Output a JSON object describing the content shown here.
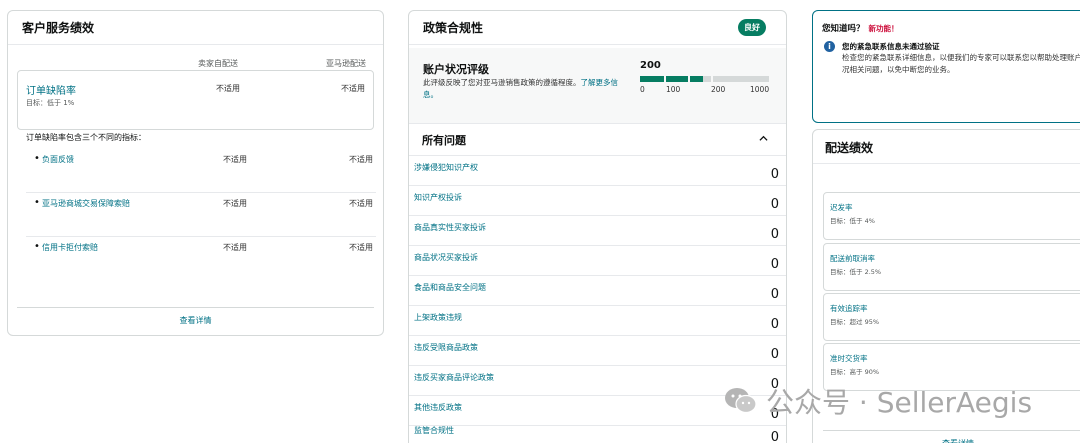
{
  "csp": {
    "title": "客户服务绩效",
    "col_seller": "卖家自配送",
    "col_amazon": "亚马逊配送",
    "odr": {
      "title": "订单缺陷率",
      "target": "目标：低于 1%",
      "seller": "不适用",
      "amazon": "不适用"
    },
    "intro": "订单缺陷率包含三个不同的指标：",
    "metrics": [
      {
        "label": "负面反馈",
        "seller": "不适用",
        "amazon": "不适用"
      },
      {
        "label": "亚马逊商城交易保障索赔",
        "seller": "不适用",
        "amazon": "不适用"
      },
      {
        "label": "信用卡拒付索赔",
        "seller": "不适用",
        "amazon": "不适用"
      }
    ],
    "view_details": "查看详情"
  },
  "policy": {
    "title": "政策合规性",
    "badge": "良好",
    "badge_color": "#067d62",
    "ahr": {
      "title": "账户状况评级",
      "desc": "此评级反映了您对亚马逊销售政策的遵循程度。",
      "desc_link": "了解更多信息。",
      "score": "200",
      "score_value": 200,
      "bar_max": 1000,
      "ticks": [
        "0",
        "100",
        "200",
        "1000"
      ]
    },
    "issues_title": "所有问题",
    "issues": [
      {
        "label": "涉嫌侵犯知识产权",
        "count": "0"
      },
      {
        "label": "知识产权投诉",
        "count": "0"
      },
      {
        "label": "商品真实性买家投诉",
        "count": "0"
      },
      {
        "label": "商品状况买家投诉",
        "count": "0"
      },
      {
        "label": "食品和商品安全问题",
        "count": "0"
      },
      {
        "label": "上架政策违规",
        "count": "0"
      },
      {
        "label": "违反受限商品政策",
        "count": "0"
      },
      {
        "label": "违反买家商品评论政策",
        "count": "0"
      },
      {
        "label": "其他违反政策",
        "count": "0"
      },
      {
        "label": "监管合规性",
        "count": "0"
      }
    ]
  },
  "dyk": {
    "title": "您知道吗？",
    "new_label": "新功能！",
    "heading": "您的紧急联系信息未通过验证",
    "body": "检查您的紧急联系详细信息，以便我们的专家可以联系您以帮助处理账户状况相关问题，以免中断您的业务。"
  },
  "shipping": {
    "title": "配送绩效",
    "metrics": [
      {
        "label": "迟发率",
        "target": "目标：低于 4%"
      },
      {
        "label": "配送前取消率",
        "target": "目标：低于 2.5%"
      },
      {
        "label": "有效追踪率",
        "target": "目标：超过 95%"
      },
      {
        "label": "准时交货率",
        "target": "目标：高于 90%"
      }
    ],
    "view_details": "查看详情"
  },
  "watermark": {
    "text": "公众号 · SellerAegis"
  }
}
